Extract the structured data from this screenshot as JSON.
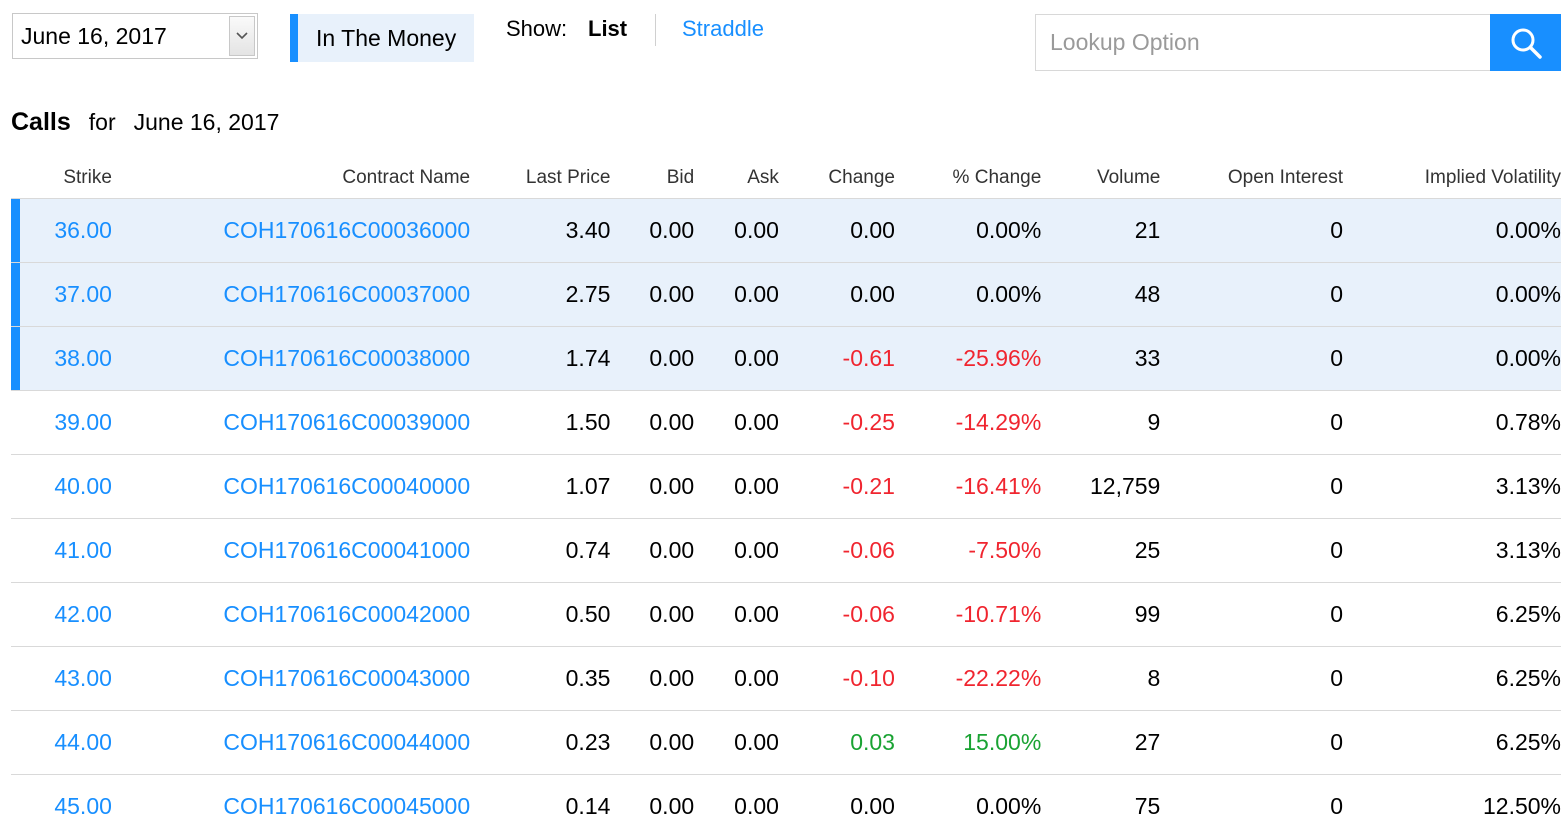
{
  "controls": {
    "expiration_date": "June 16, 2017",
    "in_the_money_label": "In The Money",
    "show_label": "Show:",
    "show_list_label": "List",
    "show_straddle_label": "Straddle",
    "lookup_placeholder": "Lookup Option",
    "search_icon": "search-icon"
  },
  "heading": {
    "title": "Calls",
    "for_label": "for",
    "date": "June 16, 2017"
  },
  "columns": [
    "Strike",
    "Contract Name",
    "Last Price",
    "Bid",
    "Ask",
    "Change",
    "% Change",
    "Volume",
    "Open Interest",
    "Implied Volatility"
  ],
  "rows": [
    {
      "strike": "36.00",
      "contract": "COH170616C00036000",
      "last": "3.40",
      "bid": "0.00",
      "ask": "0.00",
      "change": "0.00",
      "pct_change": "0.00%",
      "volume": "21",
      "open_interest": "0",
      "iv": "0.00%",
      "in_the_money": true,
      "direction": "flat"
    },
    {
      "strike": "37.00",
      "contract": "COH170616C00037000",
      "last": "2.75",
      "bid": "0.00",
      "ask": "0.00",
      "change": "0.00",
      "pct_change": "0.00%",
      "volume": "48",
      "open_interest": "0",
      "iv": "0.00%",
      "in_the_money": true,
      "direction": "flat"
    },
    {
      "strike": "38.00",
      "contract": "COH170616C00038000",
      "last": "1.74",
      "bid": "0.00",
      "ask": "0.00",
      "change": "-0.61",
      "pct_change": "-25.96%",
      "volume": "33",
      "open_interest": "0",
      "iv": "0.00%",
      "in_the_money": true,
      "direction": "down"
    },
    {
      "strike": "39.00",
      "contract": "COH170616C00039000",
      "last": "1.50",
      "bid": "0.00",
      "ask": "0.00",
      "change": "-0.25",
      "pct_change": "-14.29%",
      "volume": "9",
      "open_interest": "0",
      "iv": "0.78%",
      "in_the_money": false,
      "direction": "down"
    },
    {
      "strike": "40.00",
      "contract": "COH170616C00040000",
      "last": "1.07",
      "bid": "0.00",
      "ask": "0.00",
      "change": "-0.21",
      "pct_change": "-16.41%",
      "volume": "12,759",
      "open_interest": "0",
      "iv": "3.13%",
      "in_the_money": false,
      "direction": "down"
    },
    {
      "strike": "41.00",
      "contract": "COH170616C00041000",
      "last": "0.74",
      "bid": "0.00",
      "ask": "0.00",
      "change": "-0.06",
      "pct_change": "-7.50%",
      "volume": "25",
      "open_interest": "0",
      "iv": "3.13%",
      "in_the_money": false,
      "direction": "down"
    },
    {
      "strike": "42.00",
      "contract": "COH170616C00042000",
      "last": "0.50",
      "bid": "0.00",
      "ask": "0.00",
      "change": "-0.06",
      "pct_change": "-10.71%",
      "volume": "99",
      "open_interest": "0",
      "iv": "6.25%",
      "in_the_money": false,
      "direction": "down"
    },
    {
      "strike": "43.00",
      "contract": "COH170616C00043000",
      "last": "0.35",
      "bid": "0.00",
      "ask": "0.00",
      "change": "-0.10",
      "pct_change": "-22.22%",
      "volume": "8",
      "open_interest": "0",
      "iv": "6.25%",
      "in_the_money": false,
      "direction": "down"
    },
    {
      "strike": "44.00",
      "contract": "COH170616C00044000",
      "last": "0.23",
      "bid": "0.00",
      "ask": "0.00",
      "change": "0.03",
      "pct_change": "15.00%",
      "volume": "27",
      "open_interest": "0",
      "iv": "6.25%",
      "in_the_money": false,
      "direction": "up"
    },
    {
      "strike": "45.00",
      "contract": "COH170616C00045000",
      "last": "0.14",
      "bid": "0.00",
      "ask": "0.00",
      "change": "0.00",
      "pct_change": "0.00%",
      "volume": "75",
      "open_interest": "0",
      "iv": "12.50%",
      "in_the_money": false,
      "direction": "flat"
    }
  ],
  "colors": {
    "accent": "#188fff",
    "itm_background": "#e8f1fb",
    "negative": "#f0252f",
    "positive": "#1aa333"
  }
}
